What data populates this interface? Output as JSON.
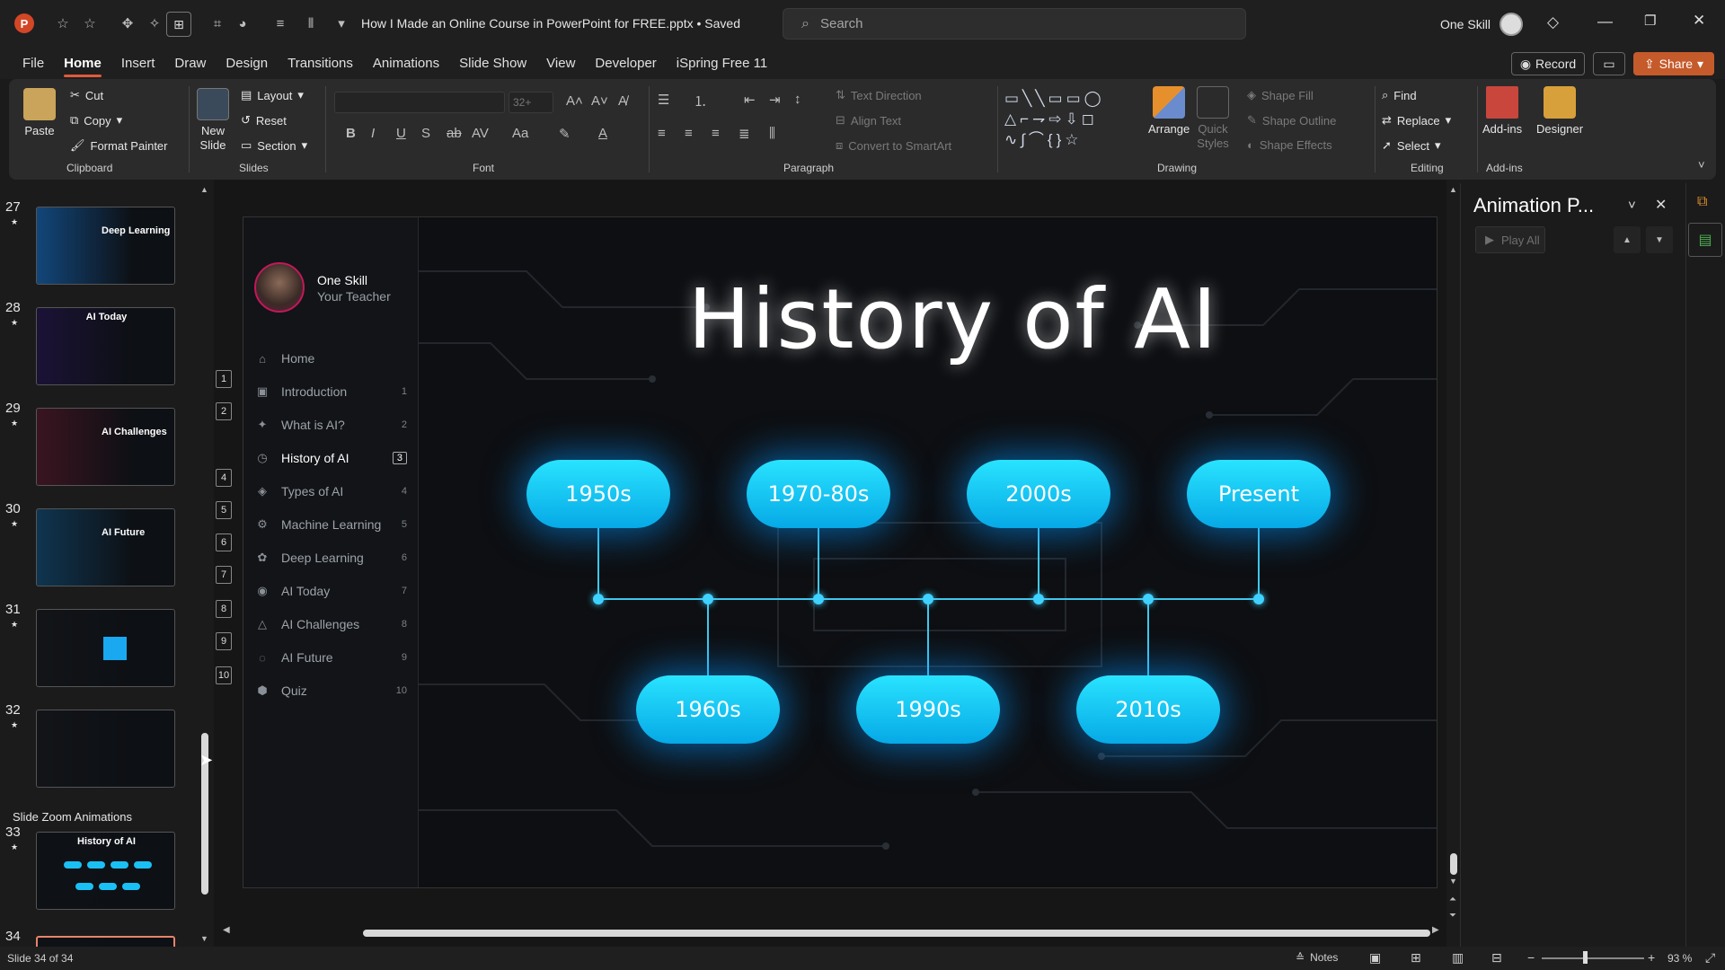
{
  "app": {
    "document_title": "How I Made an Online Course in PowerPoint for FREE.pptx • Saved",
    "search_placeholder": "Search",
    "user_name": "One Skill"
  },
  "menu": [
    "File",
    "Home",
    "Insert",
    "Draw",
    "Design",
    "Transitions",
    "Animations",
    "Slide Show",
    "View",
    "Developer",
    "iSpring Free 11"
  ],
  "menu_active": "Home",
  "header_buttons": {
    "record": "Record",
    "share": "Share"
  },
  "ribbon": {
    "clipboard": {
      "paste": "Paste",
      "cut": "Cut",
      "copy": "Copy",
      "format_painter": "Format Painter",
      "label": "Clipboard"
    },
    "slides": {
      "new_slide": "New Slide",
      "layout": "Layout",
      "reset": "Reset",
      "section": "Section",
      "label": "Slides"
    },
    "font": {
      "size": "32+",
      "label": "Font"
    },
    "paragraph": {
      "text_direction": "Text Direction",
      "align_text": "Align Text",
      "smartart": "Convert to SmartArt",
      "label": "Paragraph"
    },
    "drawing": {
      "arrange": "Arrange",
      "quick_styles": "Quick Styles",
      "shape_fill": "Shape Fill",
      "shape_outline": "Shape Outline",
      "shape_effects": "Shape Effects",
      "label": "Drawing"
    },
    "editing": {
      "find": "Find",
      "replace": "Replace",
      "select": "Select",
      "label": "Editing"
    },
    "addins": {
      "addins": "Add-ins",
      "designer": "Designer",
      "label": "Add-ins"
    }
  },
  "thumbnails": [
    {
      "num": "27",
      "title": "Deep Learning"
    },
    {
      "num": "28",
      "title": "AI Today"
    },
    {
      "num": "29",
      "title": "AI Challenges"
    },
    {
      "num": "30",
      "title": "AI Future"
    },
    {
      "num": "31",
      "title": ""
    },
    {
      "num": "32",
      "title": ""
    },
    {
      "num": "33",
      "title": "History of AI"
    },
    {
      "num": "34",
      "title": ""
    }
  ],
  "section_header": "Slide Zoom Animations",
  "slide": {
    "profile_name": "One Skill",
    "profile_role": "Your Teacher",
    "title": "History of AI",
    "nav": [
      {
        "label": "Home",
        "count": "",
        "icon": "⌂"
      },
      {
        "label": "Introduction",
        "count": "1",
        "icon": "▣"
      },
      {
        "label": "What is AI?",
        "count": "2",
        "icon": "✦"
      },
      {
        "label": "History of AI",
        "count": "3",
        "icon": "◷"
      },
      {
        "label": "Types of AI",
        "count": "4",
        "icon": "◈"
      },
      {
        "label": "Machine Learning",
        "count": "5",
        "icon": "⚙"
      },
      {
        "label": "Deep Learning",
        "count": "6",
        "icon": "✿"
      },
      {
        "label": "AI Today",
        "count": "7",
        "icon": "◉"
      },
      {
        "label": "AI Challenges",
        "count": "8",
        "icon": "△"
      },
      {
        "label": "AI Future",
        "count": "9",
        "icon": "◌"
      },
      {
        "label": "Quiz",
        "count": "10",
        "icon": "⬢"
      }
    ],
    "active_nav": "History of AI",
    "top_eras": [
      "1950s",
      "1970-80s",
      "2000s",
      "Present"
    ],
    "bottom_eras": [
      "1960s",
      "1990s",
      "2010s"
    ],
    "zoom_badges": [
      "1",
      "2",
      "4",
      "5",
      "6",
      "7",
      "8",
      "9",
      "10"
    ]
  },
  "animation_pane": {
    "title": "Animation P...",
    "play_all": "Play All"
  },
  "status": {
    "slide_counter": "Slide 34 of 34",
    "notes": "Notes",
    "zoom": "93 %"
  },
  "colors": {
    "accent": "#e05a3a",
    "pill": "#0fb8f0",
    "share": "#c55a2b"
  }
}
